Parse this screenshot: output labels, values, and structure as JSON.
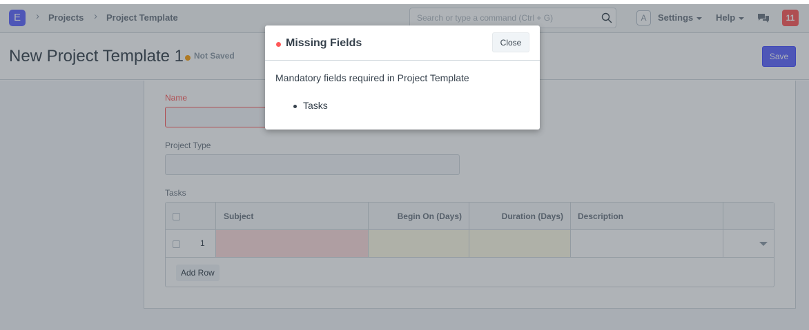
{
  "navbar": {
    "logo_letter": "E",
    "breadcrumbs": [
      "Projects",
      "Project Template"
    ],
    "search_placeholder": "Search or type a command (Ctrl + G)",
    "avatar_letter": "A",
    "settings_label": "Settings",
    "help_label": "Help",
    "notification_count": "11"
  },
  "page": {
    "title": "New Project Template 1",
    "status": "Not Saved",
    "save_label": "Save"
  },
  "form": {
    "name_label": "Name",
    "name_value": "",
    "project_type_label": "Project Type",
    "project_type_value": "",
    "tasks_label": "Tasks",
    "tasks_table": {
      "columns": [
        "Subject",
        "Begin On (Days)",
        "Duration (Days)",
        "Description"
      ],
      "rows": [
        {
          "index": "1",
          "subject": "",
          "begin_on": "",
          "duration": "",
          "description": ""
        }
      ],
      "add_row_label": "Add Row"
    }
  },
  "modal": {
    "title": "Missing Fields",
    "close_label": "Close",
    "message": "Mandatory fields required in Project Template",
    "missing_fields": [
      "Tasks"
    ]
  },
  "colors": {
    "brand": "#5e64ff",
    "error": "#ff5858",
    "warning": "#ffa00a",
    "overlay": "rgba(54,65,76,0.4)"
  }
}
